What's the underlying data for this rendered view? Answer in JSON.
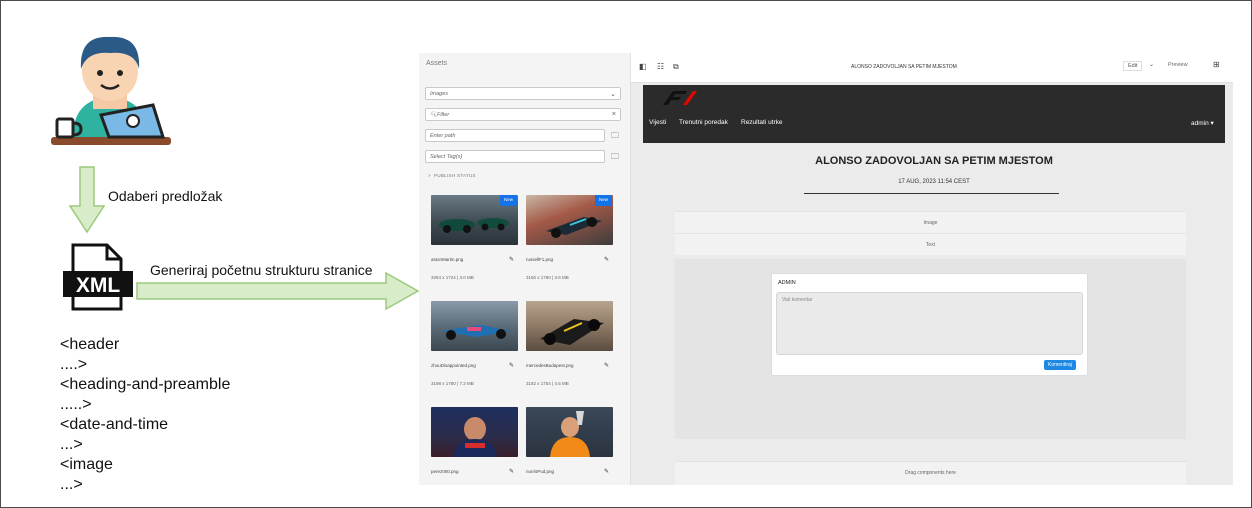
{
  "flow": {
    "step1_label": "Odaberi predložak",
    "step2_label": "Generiraj početnu strukturu stranice",
    "xml_icon_text": "XML",
    "tags": [
      "<header",
      "....>",
      "<heading-and-preamble",
      ".....>",
      "<date-and-time",
      "...>",
      "<image",
      "...>"
    ]
  },
  "assets": {
    "title": "Assets",
    "type_select": "Images",
    "filter_placeholder": "Filter",
    "path_placeholder": "Enter path",
    "tags_placeholder": "Select Tag(s)",
    "publish_status": "PUBLISH STATUS",
    "new_badge": "New",
    "items": [
      {
        "name": "astonMartin.png",
        "meta": "3284 x 1724 | 3.0 MB",
        "new": true
      },
      {
        "name": "russellF1.png",
        "meta": "3160 x 1780 | 3.6 MB",
        "new": true
      },
      {
        "name": "zhouDisappointed.png",
        "meta": "3198 x 1780 | 7.2 MB",
        "new": false
      },
      {
        "name": "mercedesBudapest.png",
        "meta": "3182 x 1754 | 4.5 MB",
        "new": false
      },
      {
        "name": "perez000.png",
        "meta": "",
        "new": false
      },
      {
        "name": "norrisPod.png",
        "meta": "",
        "new": false
      }
    ]
  },
  "editor": {
    "doc_title": "ALONSO ZADOVOLJAN SA PETIM MJESTOM",
    "edit_label": "Edit",
    "preview_label": "Preview"
  },
  "site": {
    "nav": [
      "Vijesti",
      "Trenutni poredak",
      "Rezultati utrke"
    ],
    "admin_menu": "admin ▾",
    "heading": "ALONSO ZADOVOLJAN SA PETIM MJESTOM",
    "date": "17 AUG, 2023 11:54 CEST",
    "image_block": "Image",
    "text_block": "Text",
    "comment_user": "ADMIN",
    "comment_placeholder": "Vaš komentar",
    "comment_button": "Komentiraj",
    "drag_label": "Drag components here"
  },
  "colors": {
    "arrow_fill": "#d9ecc9",
    "arrow_stroke": "#9cc97a",
    "accent_blue": "#1473e6",
    "site_header": "#2b2b2b"
  }
}
